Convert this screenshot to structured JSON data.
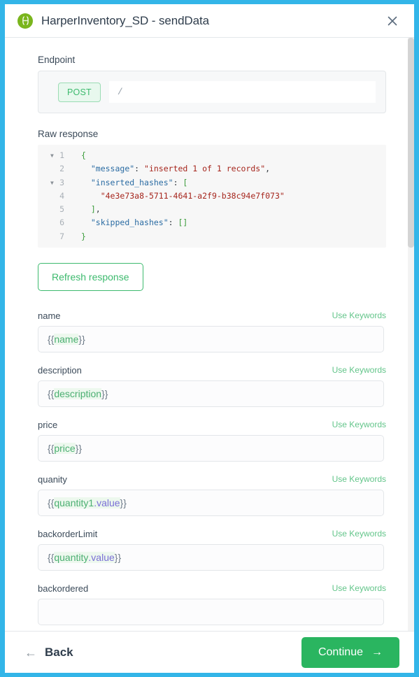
{
  "window": {
    "frame_color": "#33b5e8",
    "title": "HarperInventory_SD - sendData",
    "app_icon": "harper-braces-icon",
    "close_icon": "close-icon"
  },
  "endpoint": {
    "label": "Endpoint",
    "method": "POST",
    "method_color": "#3dba6e",
    "path": "/"
  },
  "raw_response": {
    "label": "Raw response",
    "line_numbers": [
      "1",
      "2",
      "3",
      "4",
      "5",
      "6",
      "7"
    ],
    "fold_lines": [
      1,
      3
    ],
    "lines": [
      {
        "n": "1",
        "tokens": [
          {
            "t": "{",
            "c": "punc"
          }
        ]
      },
      {
        "n": "2",
        "tokens": [
          {
            "t": "  ",
            "c": "plain"
          },
          {
            "t": "\"message\"",
            "c": "key"
          },
          {
            "t": ": ",
            "c": "plain"
          },
          {
            "t": "\"inserted 1 of 1 records\"",
            "c": "str"
          },
          {
            "t": ",",
            "c": "plain"
          }
        ]
      },
      {
        "n": "3",
        "tokens": [
          {
            "t": "  ",
            "c": "plain"
          },
          {
            "t": "\"inserted_hashes\"",
            "c": "key"
          },
          {
            "t": ": ",
            "c": "plain"
          },
          {
            "t": "[",
            "c": "punc"
          }
        ]
      },
      {
        "n": "4",
        "tokens": [
          {
            "t": "    ",
            "c": "plain"
          },
          {
            "t": "\"4e3e73a8-5711-4641-a2f9-b38c94e7f073\"",
            "c": "str"
          }
        ]
      },
      {
        "n": "5",
        "tokens": [
          {
            "t": "  ",
            "c": "plain"
          },
          {
            "t": "]",
            "c": "punc"
          },
          {
            "t": ",",
            "c": "plain"
          }
        ]
      },
      {
        "n": "6",
        "tokens": [
          {
            "t": "  ",
            "c": "plain"
          },
          {
            "t": "\"skipped_hashes\"",
            "c": "key"
          },
          {
            "t": ": ",
            "c": "plain"
          },
          {
            "t": "[]",
            "c": "punc"
          }
        ]
      },
      {
        "n": "7",
        "tokens": [
          {
            "t": "}",
            "c": "punc"
          }
        ]
      }
    ]
  },
  "refresh_button": {
    "label": "Refresh response"
  },
  "fields": [
    {
      "label": "name",
      "keywords_label": "Use Keywords",
      "value_parts": [
        {
          "t": "{{",
          "c": "brace"
        },
        {
          "t": "name",
          "c": "var"
        },
        {
          "t": "}}",
          "c": "brace"
        }
      ],
      "value": "{{name}}"
    },
    {
      "label": "description",
      "keywords_label": "Use Keywords",
      "value_parts": [
        {
          "t": "{{",
          "c": "brace"
        },
        {
          "t": "description",
          "c": "var"
        },
        {
          "t": "}}",
          "c": "brace"
        }
      ],
      "value": "{{description}}"
    },
    {
      "label": "price",
      "keywords_label": "Use Keywords",
      "value_parts": [
        {
          "t": "{{",
          "c": "brace"
        },
        {
          "t": "price",
          "c": "var"
        },
        {
          "t": "}}",
          "c": "brace"
        }
      ],
      "value": "{{price}}"
    },
    {
      "label": "quanity",
      "keywords_label": "Use Keywords",
      "value_parts": [
        {
          "t": "{{",
          "c": "brace"
        },
        {
          "t": "quantity1",
          "c": "var"
        },
        {
          "t": ".value",
          "c": "prop"
        },
        {
          "t": "}}",
          "c": "brace"
        }
      ],
      "value": "{{quantity1.value}}"
    },
    {
      "label": "backorderLimit",
      "keywords_label": "Use Keywords",
      "value_parts": [
        {
          "t": "{{",
          "c": "brace"
        },
        {
          "t": "quantity",
          "c": "var"
        },
        {
          "t": ".value",
          "c": "prop"
        },
        {
          "t": "}}",
          "c": "brace"
        }
      ],
      "value": "{{quantity.value}}"
    },
    {
      "label": "backordered",
      "keywords_label": "Use Keywords",
      "value_parts": [],
      "value": ""
    }
  ],
  "footer": {
    "back_label": "Back",
    "back_icon": "arrow-left-icon",
    "continue_label": "Continue",
    "continue_icon": "arrow-right-icon",
    "continue_color": "#2ab560"
  }
}
